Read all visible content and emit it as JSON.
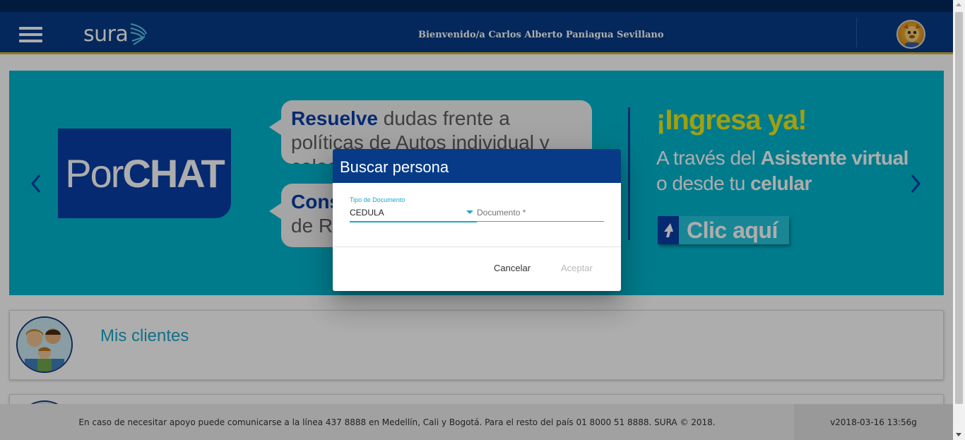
{
  "header": {
    "logo_text": "sura",
    "welcome": "Bienvenido/a Carlos Alberto Paniagua Sevillano"
  },
  "banner": {
    "porchat_prefix": "Por",
    "porchat_bold": "CHAT",
    "bubble1_bold": "Resuelve",
    "bubble1_text": " dudas frente a políticas de Autos individual y colectivo.",
    "bubble2_bold": "Cons",
    "bubble2_text": "de RC",
    "headline": "¡Ingresa ya!",
    "line1_prefix": "A través del ",
    "line1_bold": "Asistente virtual",
    "line2_prefix": "o desde tu ",
    "line2_bold": "celular",
    "cta_label": "Clic aquí"
  },
  "cards": [
    {
      "title": "Mis clientes"
    }
  ],
  "footer": {
    "text": "En caso de necesitar apoyo puede comunicarse a la línea 437 8888 en Medellín, Cali y Bogotá. Para el resto del país 01 8000 51 8888. SURA © 2018.",
    "version": "v2018-03-16 13:56g"
  },
  "dialog": {
    "title": "Buscar persona",
    "doc_type_label": "Tipo de Documento",
    "doc_type_value": "CEDULA",
    "doc_placeholder": "Documento *",
    "cancel_label": "Cancelar",
    "accept_label": "Aceptar"
  },
  "colors": {
    "header_bg": "#073b87",
    "accent_gold": "#d9b62b",
    "banner_bg": "#00b5cf",
    "brand_blue": "#0a3fa7",
    "cyan_accent": "#1aa7c9",
    "headline_yellow": "#ecec1a"
  },
  "icons": [
    "menu-icon",
    "sura-logo-icon",
    "user-avatar",
    "chevron-left-icon",
    "chevron-right-icon",
    "cursor-arrow-icon",
    "dropdown-caret-icon"
  ]
}
